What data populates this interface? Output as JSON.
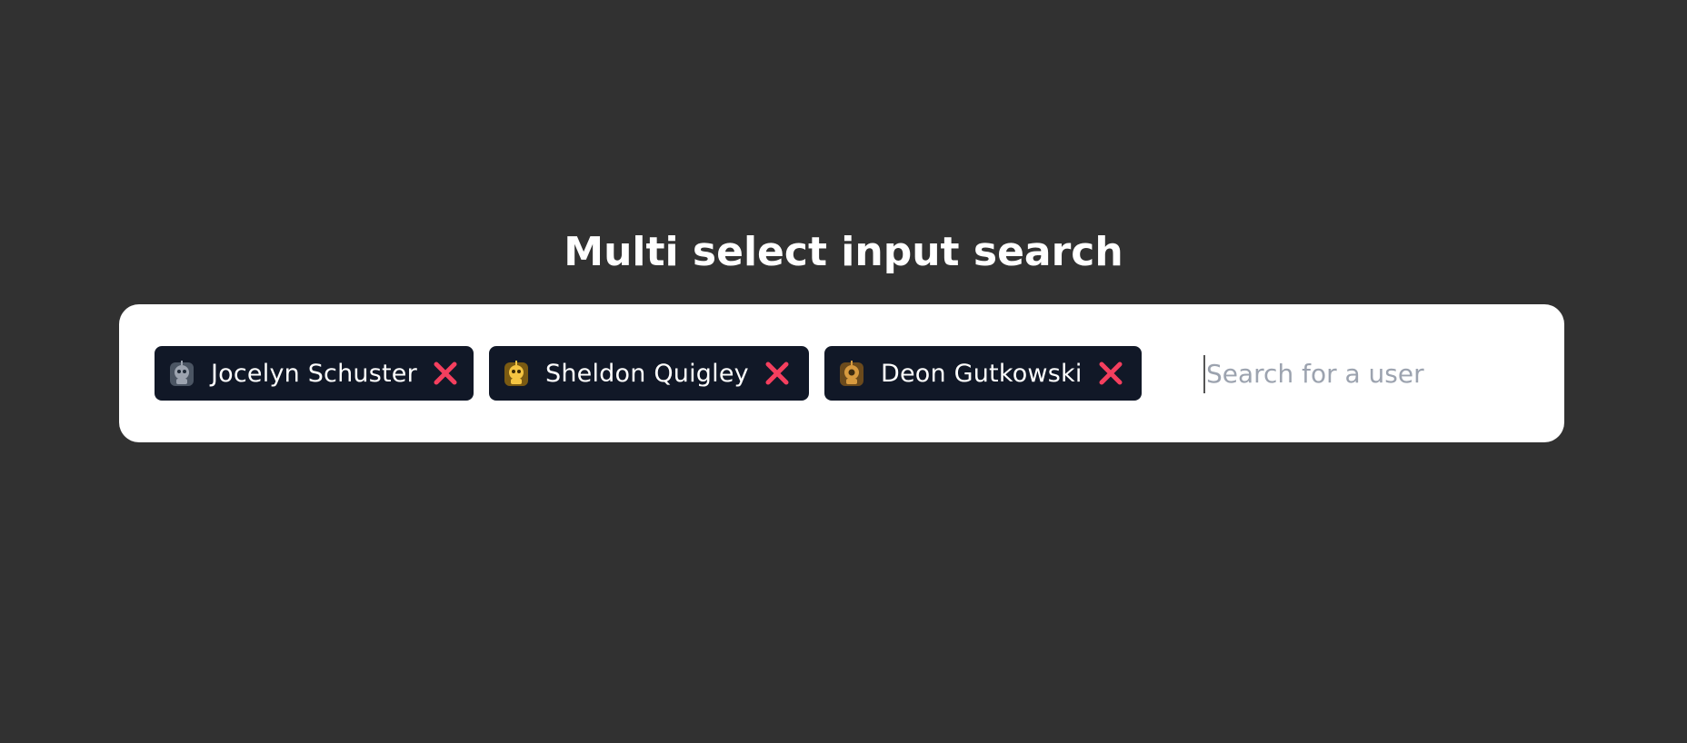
{
  "page": {
    "title": "Multi select input search"
  },
  "search": {
    "placeholder": "Search for a user",
    "value": ""
  },
  "selected_users": [
    {
      "name": "Jocelyn Schuster",
      "avatar_icon": "robot-avatar-icon",
      "avatar_color": "#9ca3af"
    },
    {
      "name": "Sheldon Quigley",
      "avatar_icon": "robot-avatar-icon",
      "avatar_color": "#f5c542"
    },
    {
      "name": "Deon Gutkowski",
      "avatar_icon": "robot-avatar-icon",
      "avatar_color": "#d79a3f"
    }
  ],
  "remove_icon": {
    "name": "close-icon",
    "color": "#f43f5e"
  },
  "colors": {
    "background": "#313131",
    "panel": "#ffffff",
    "chip": "#111827"
  }
}
